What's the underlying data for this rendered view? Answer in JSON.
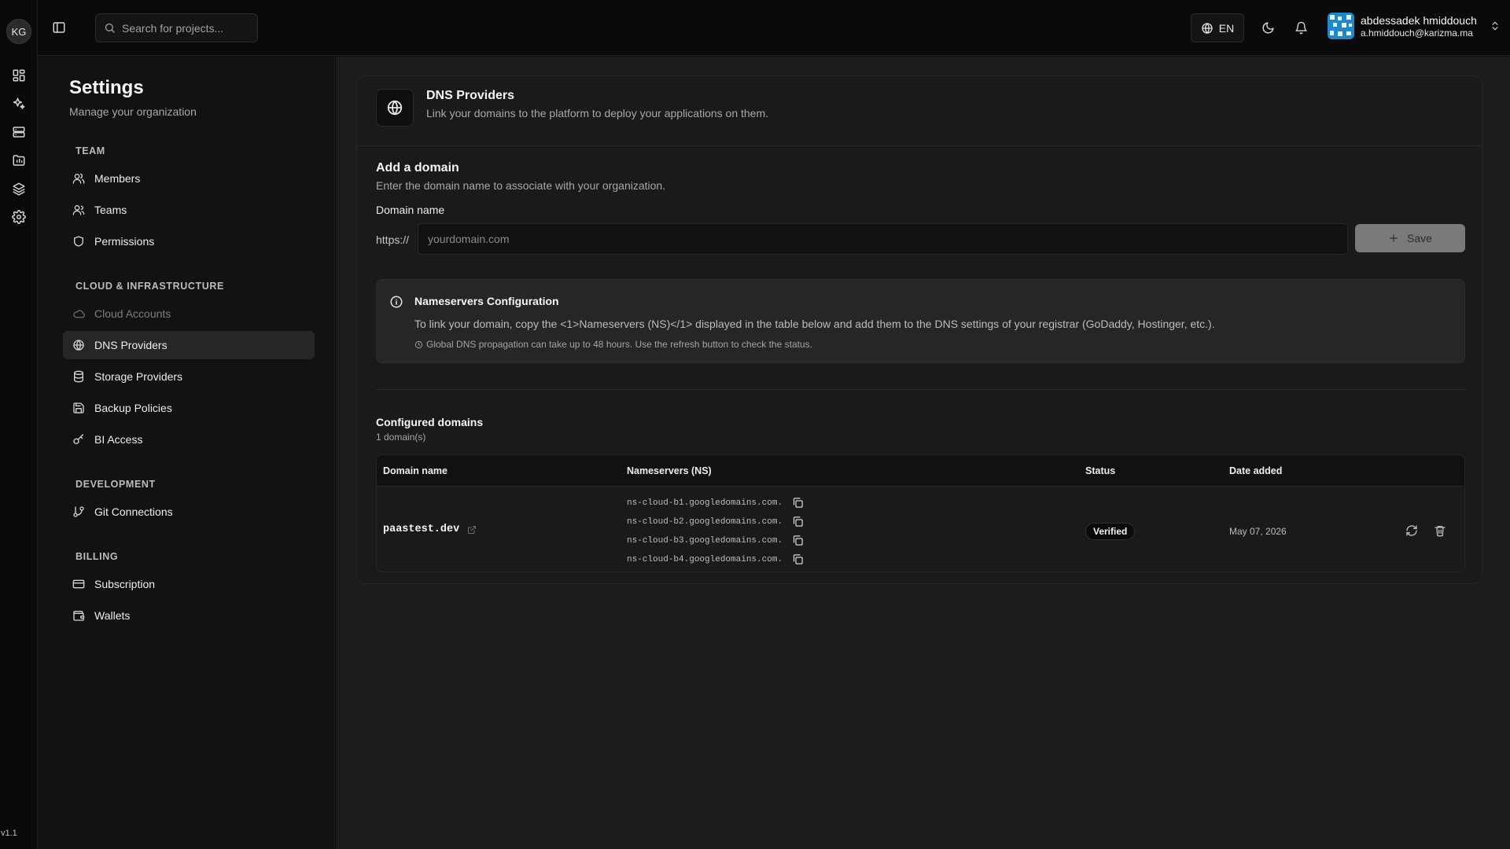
{
  "rail": {
    "org_initials": "KG",
    "version": "v1.1",
    "icons": [
      "dashboard-icon",
      "sparkles-icon",
      "server-icon",
      "folder-icon",
      "layers-icon",
      "gear-icon"
    ]
  },
  "topbar": {
    "search_placeholder": "Search for projects...",
    "language": "EN",
    "user_name": "abdessadek hmiddouch",
    "user_email": "a.hmiddouch@karizma.ma"
  },
  "settings": {
    "title": "Settings",
    "subtitle": "Manage your organization",
    "sections": {
      "team": "TEAM",
      "cloud": "CLOUD & INFRASTRUCTURE",
      "development": "DEVELOPMENT",
      "billing": "BILLING"
    },
    "items": {
      "members": "Members",
      "teams": "Teams",
      "permissions": "Permissions",
      "cloud_accounts": "Cloud Accounts",
      "dns_providers": "DNS Providers",
      "storage_providers": "Storage Providers",
      "backup_policies": "Backup Policies",
      "bi_access": "BI Access",
      "git_connections": "Git Connections",
      "subscription": "Subscription",
      "wallets": "Wallets"
    }
  },
  "page": {
    "title": "DNS Providers",
    "description": "Link your domains to the platform to deploy your applications on them."
  },
  "add_domain": {
    "title": "Add a domain",
    "description": "Enter the domain name to associate with your organization.",
    "field_label": "Domain name",
    "prefix": "https://",
    "placeholder": "yourdomain.com",
    "save_label": "Save"
  },
  "nameservers_info": {
    "title": "Nameservers Configuration",
    "text": "To link your domain, copy the <1>Nameservers (NS)</1> displayed in the table below and add them to the DNS settings of your registrar (GoDaddy, Hostinger, etc.).",
    "note": "Global DNS propagation can take up to 48 hours. Use the refresh button to check the status."
  },
  "configured": {
    "title": "Configured domains",
    "count": "1 domain(s)",
    "columns": {
      "domain": "Domain name",
      "nameservers": "Nameservers (NS)",
      "status": "Status",
      "date": "Date added"
    },
    "rows": [
      {
        "domain": "paastest.dev",
        "nameservers": [
          "ns-cloud-b1.googledomains.com.",
          "ns-cloud-b2.googledomains.com.",
          "ns-cloud-b3.googledomains.com.",
          "ns-cloud-b4.googledomains.com."
        ],
        "status": "Verified",
        "date": "May 07, 2026"
      }
    ]
  }
}
